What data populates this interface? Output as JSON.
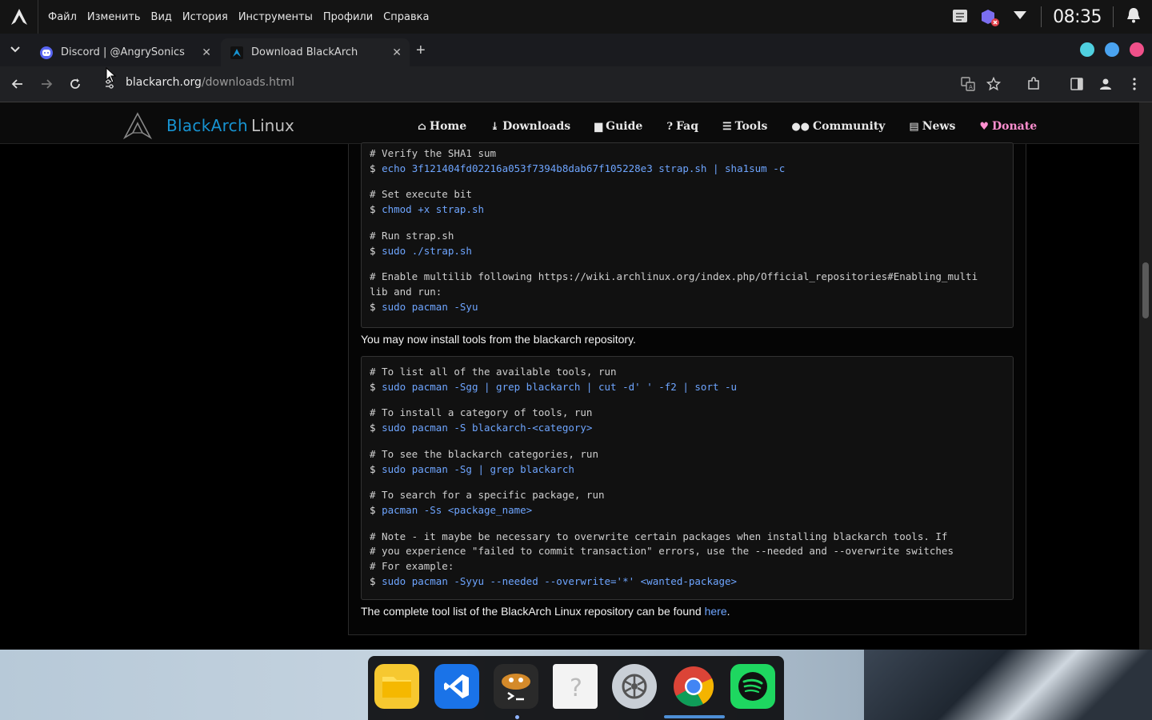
{
  "os_panel": {
    "menu": [
      "Файл",
      "Изменить",
      "Вид",
      "История",
      "Инструменты",
      "Профили",
      "Справка"
    ],
    "clock": "08:35",
    "icons": [
      "arch-logo-icon",
      "clipboard-icon",
      "shield-muted-icon",
      "dropdown-triangle-icon",
      "bell-icon"
    ]
  },
  "tabs": [
    {
      "title": "Discord | @AngrySonics",
      "favicon": "discord-icon",
      "active": false
    },
    {
      "title": "Download BlackArch",
      "favicon": "blackarch-icon",
      "active": true
    }
  ],
  "window_buttons": {
    "colors": [
      "#4fd0e0",
      "#4aa3f0",
      "#f0508a"
    ]
  },
  "address_bar": {
    "domain": "blackarch.org",
    "path": "/downloads.html"
  },
  "site": {
    "brand_primary": "BlackArch",
    "brand_secondary": "Linux",
    "nav": [
      {
        "label": "Home",
        "icon": "home-icon"
      },
      {
        "label": "Downloads",
        "icon": "download-icon"
      },
      {
        "label": "Guide",
        "icon": "book-icon"
      },
      {
        "label": "Faq",
        "icon": "question-icon"
      },
      {
        "label": "Tools",
        "icon": "list-icon"
      },
      {
        "label": "Community",
        "icon": "users-icon"
      },
      {
        "label": "News",
        "icon": "newspaper-icon"
      },
      {
        "label": "Donate",
        "icon": "heart-icon"
      }
    ],
    "accent": "#1793d1",
    "link_color": "#6ea5ff"
  },
  "code_block_1": [
    {
      "type": "comment",
      "text": "# Verify the SHA1 sum"
    },
    {
      "type": "cmd",
      "text": "echo 3f121404fd02216a053f7394b8dab67f105228e3 strap.sh | sha1sum -c"
    },
    {
      "type": "gap"
    },
    {
      "type": "comment",
      "text": "# Set execute bit"
    },
    {
      "type": "cmd",
      "text": "chmod +x strap.sh"
    },
    {
      "type": "gap"
    },
    {
      "type": "comment",
      "text": "# Run strap.sh"
    },
    {
      "type": "cmd",
      "text": "sudo ./strap.sh"
    },
    {
      "type": "gap"
    },
    {
      "type": "comment",
      "text": "# Enable multilib following https://wiki.archlinux.org/index.php/Official_repositories#Enabling_multi"
    },
    {
      "type": "comment",
      "text": "lib and run:"
    },
    {
      "type": "cmd",
      "text": "sudo pacman -Syu"
    }
  ],
  "prose_1": "You may now install tools from the blackarch repository.",
  "code_block_2": [
    {
      "type": "comment",
      "text": "# To list all of the available tools, run"
    },
    {
      "type": "cmd",
      "text": "sudo pacman -Sgg | grep blackarch | cut -d' ' -f2 | sort -u"
    },
    {
      "type": "gap"
    },
    {
      "type": "comment",
      "text": "# To install a category of tools, run"
    },
    {
      "type": "cmd",
      "text": "sudo pacman -S blackarch-<category>"
    },
    {
      "type": "gap"
    },
    {
      "type": "comment",
      "text": "# To see the blackarch categories, run"
    },
    {
      "type": "cmd",
      "text": "sudo pacman -Sg | grep blackarch"
    },
    {
      "type": "gap"
    },
    {
      "type": "comment",
      "text": "# To search for a specific package, run"
    },
    {
      "type": "cmd",
      "text": "pacman -Ss <package_name>"
    },
    {
      "type": "gap"
    },
    {
      "type": "comment",
      "text": "# Note - it maybe be necessary to overwrite certain packages when installing blackarch tools. If"
    },
    {
      "type": "comment",
      "text": "# you experience \"failed to commit transaction\" errors, use the --needed and --overwrite switches"
    },
    {
      "type": "comment",
      "text": "# For example:"
    },
    {
      "type": "cmd",
      "text": "sudo pacman -Syyu --needed --overwrite='*' <wanted-package>"
    }
  ],
  "prose_2": {
    "text": "The complete tool list of the BlackArch Linux repository can be found ",
    "link": "here",
    "after": "."
  },
  "dock": [
    {
      "name": "files-app",
      "icon": "folder-icon"
    },
    {
      "name": "vscode-app",
      "icon": "vscode-icon"
    },
    {
      "name": "terminal-app",
      "icon": "terminal-icon"
    },
    {
      "name": "unknown-app",
      "icon": "question-file-icon"
    },
    {
      "name": "settings-app",
      "icon": "gear-icon"
    },
    {
      "name": "chrome-app",
      "icon": "chrome-icon"
    },
    {
      "name": "spotify-app",
      "icon": "spotify-icon"
    }
  ]
}
